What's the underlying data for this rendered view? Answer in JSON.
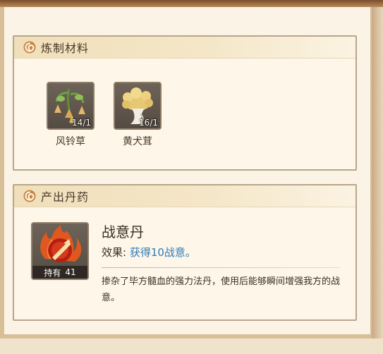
{
  "materials_panel": {
    "title": "炼制材料",
    "items": [
      {
        "name": "风铃草",
        "count": "14/1",
        "icon": "bellflower-herb-icon"
      },
      {
        "name": "黄犬茸",
        "count": "16/1",
        "icon": "yellow-fungus-icon"
      }
    ]
  },
  "output_panel": {
    "title": "产出丹药",
    "pill": {
      "name": "战意丹",
      "icon": "fire-pill-icon",
      "hold_label": "持有",
      "hold_count": "41",
      "effect_label": "效果:",
      "effect_value": "获得10战意。",
      "description": "掺杂了毕方髓血的强力法丹，使用后能够瞬间增强我方的战意。"
    }
  },
  "colors": {
    "accent_text": "#2f7bb8",
    "title_text": "#4a3a2a",
    "panel_border": "#b9a58a"
  }
}
